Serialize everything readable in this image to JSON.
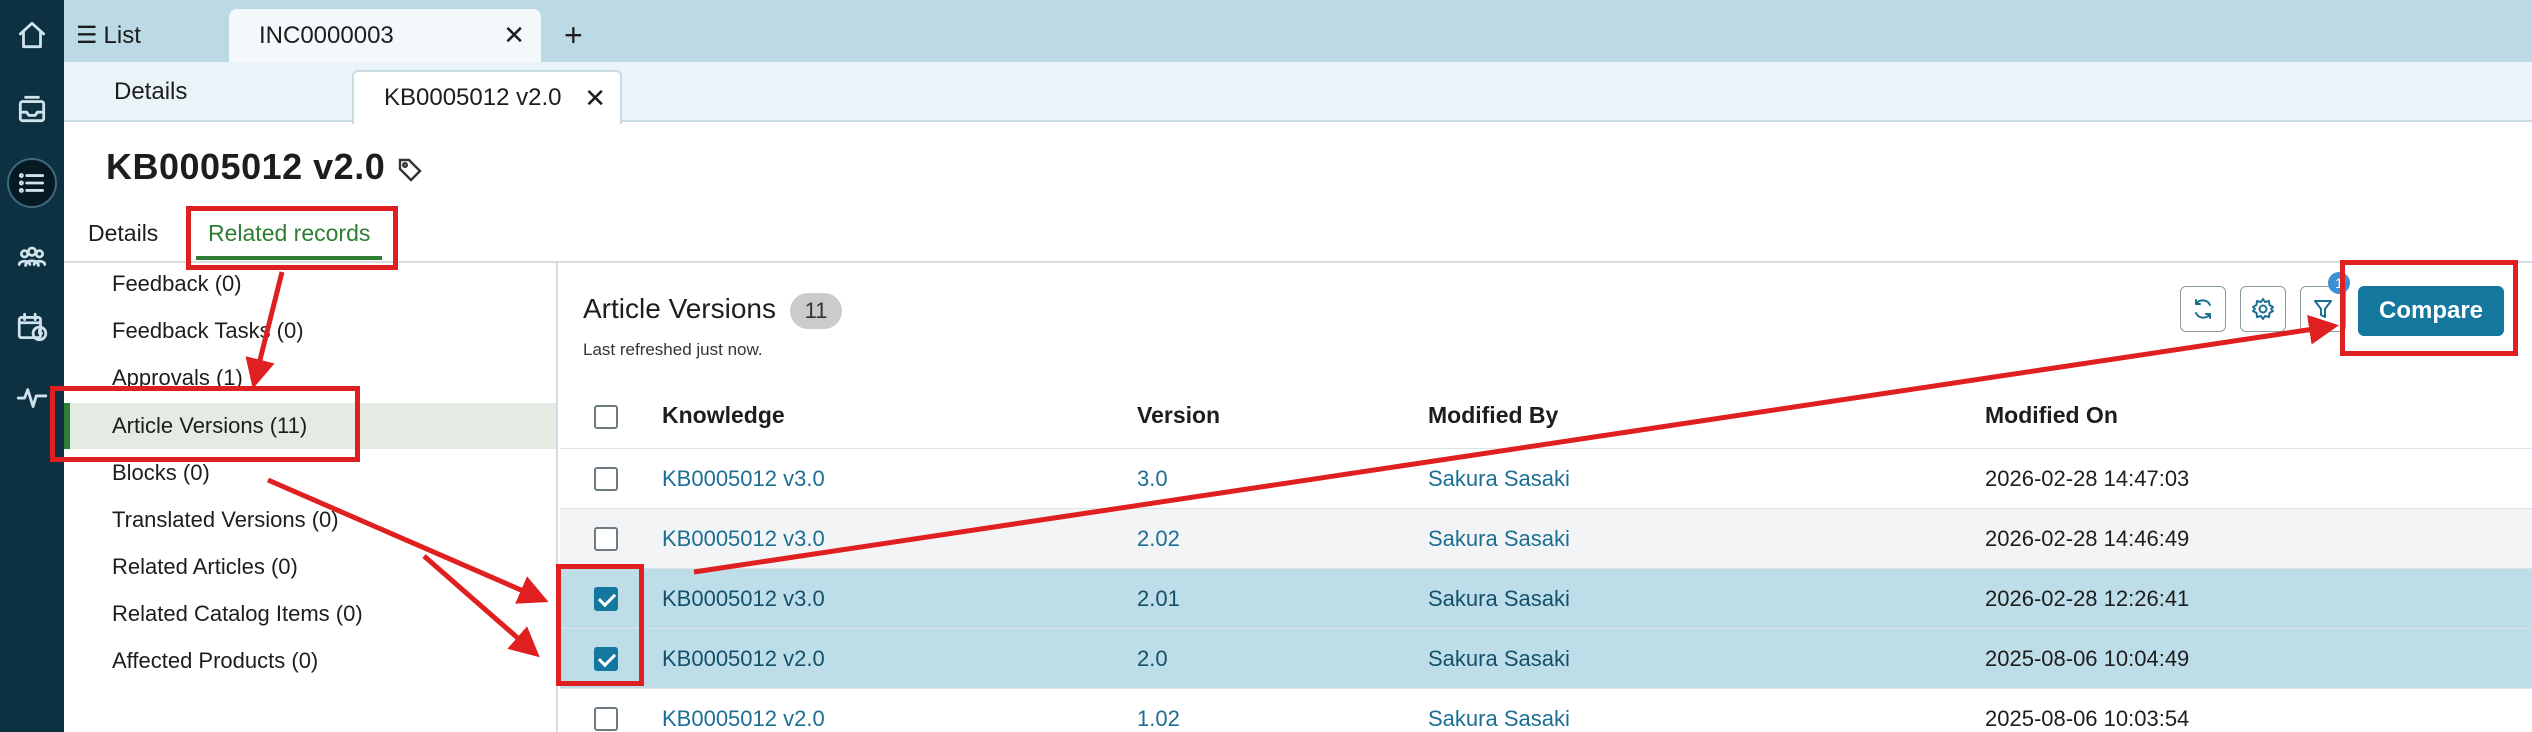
{
  "rail": {
    "icons": [
      "home-icon",
      "inbox-icon",
      "list-icon",
      "groups-icon",
      "calendar-clock-icon",
      "activity-icon"
    ]
  },
  "top_tabs": {
    "list_label": "List",
    "incident_label": "INC0000003",
    "close_glyph": "✕",
    "add_glyph": "+"
  },
  "sub_tabs": {
    "details_label": "Details",
    "kb_label": "KB0005012 v2.0",
    "close_glyph": "✕"
  },
  "record": {
    "title": "KB0005012 v2.0",
    "content_tabs": {
      "details": "Details",
      "related": "Related records"
    }
  },
  "related_list": [
    "Feedback (0)",
    "Feedback Tasks (0)",
    "Approvals (1)",
    "Article Versions (11)",
    "Blocks (0)",
    "Translated Versions (0)",
    "Related Articles (0)",
    "Related Catalog Items (0)",
    "Affected Products (0)"
  ],
  "panel": {
    "title": "Article Versions",
    "count": "11",
    "refreshed": "Last refreshed just now.",
    "compare_label": "Compare",
    "filter_badge": "1"
  },
  "table": {
    "columns": [
      "Knowledge",
      "Version",
      "Modified By",
      "Modified On"
    ],
    "rows": [
      {
        "knowledge": "KB0005012 v3.0",
        "version": "3.0",
        "modified_by": "Sakura Sasaki",
        "modified_on": "2026-02-28 14:47:03",
        "checked": false
      },
      {
        "knowledge": "KB0005012 v3.0",
        "version": "2.02",
        "modified_by": "Sakura Sasaki",
        "modified_on": "2026-02-28 14:46:49",
        "checked": false
      },
      {
        "knowledge": "KB0005012 v3.0",
        "version": "2.01",
        "modified_by": "Sakura Sasaki",
        "modified_on": "2026-02-28 12:26:41",
        "checked": true
      },
      {
        "knowledge": "KB0005012 v2.0",
        "version": "2.0",
        "modified_by": "Sakura Sasaki",
        "modified_on": "2025-08-06 10:04:49",
        "checked": true
      },
      {
        "knowledge": "KB0005012 v2.0",
        "version": "1.02",
        "modified_by": "Sakura Sasaki",
        "modified_on": "2025-08-06 10:03:54",
        "checked": false
      }
    ]
  },
  "colors": {
    "rail_bg": "#0e3142",
    "tab_bar_bg": "#bcdae6",
    "accent_green": "#2e7d32",
    "primary_button": "#13779e",
    "selected_row": "#bddde8",
    "annotation_red": "#e02020"
  }
}
